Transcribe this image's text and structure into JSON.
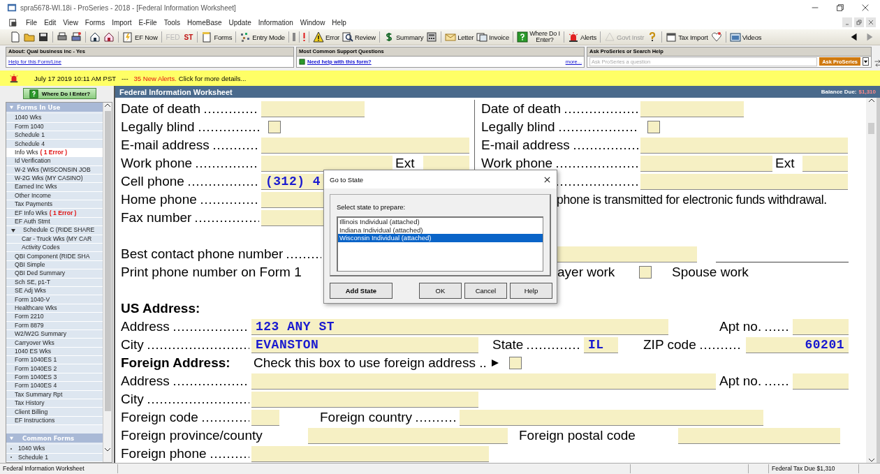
{
  "window": {
    "title": "spra5678-WI.18i - ProSeries - 2018 - [Federal Information Worksheet]"
  },
  "menu": [
    "File",
    "Edit",
    "View",
    "Forms",
    "Import",
    "E-File",
    "Tools",
    "HomeBase",
    "Update",
    "Information",
    "Window",
    "Help"
  ],
  "toolbar_groups": [
    [
      {
        "kind": "icon",
        "disabled": false
      },
      {
        "kind": "icon",
        "disabled": false
      },
      {
        "kind": "icon",
        "disabled": false
      }
    ],
    [
      {
        "kind": "icon",
        "disabled": false
      },
      {
        "kind": "icon",
        "disabled": false
      }
    ],
    [
      {
        "kind": "icon",
        "disabled": false
      },
      {
        "kind": "icon",
        "disabled": false
      }
    ],
    [
      {
        "kind": "labeled",
        "label": "EF Now",
        "disabled": false
      }
    ],
    [
      {
        "kind": "text",
        "label": "FED",
        "disabled": true
      },
      {
        "kind": "text",
        "label": "ST",
        "disabled": false
      }
    ],
    [
      {
        "kind": "labeled",
        "label": "Forms",
        "disabled": false
      }
    ],
    [
      {
        "kind": "labeled",
        "label": "Entry Mode",
        "disabled": false
      }
    ],
    [
      {
        "kind": "icon",
        "disabled": false
      }
    ],
    [
      {
        "kind": "icon",
        "disabled": false
      }
    ],
    [
      {
        "kind": "labeled",
        "label": "Error",
        "disabled": false
      },
      {
        "kind": "labeled",
        "label": "Review",
        "disabled": false
      }
    ],
    [
      {
        "kind": "labeled",
        "label": "Summary",
        "disabled": false
      },
      {
        "kind": "icon",
        "disabled": false
      }
    ],
    [
      {
        "kind": "labeled",
        "label": "Letter",
        "disabled": false
      },
      {
        "kind": "labeled",
        "label": "Invoice",
        "disabled": false
      }
    ],
    [
      {
        "kind": "labeled",
        "label": "Where Do I Enter?",
        "disabled": false
      }
    ],
    [
      {
        "kind": "labeled",
        "label": "Alerts",
        "disabled": false
      }
    ],
    [
      {
        "kind": "labeled",
        "label": "Govt Instr",
        "disabled": true
      },
      {
        "kind": "icon",
        "disabled": false
      }
    ],
    [
      {
        "kind": "labeled",
        "label": "Tax Import",
        "disabled": false
      },
      {
        "kind": "icon",
        "disabled": false
      }
    ],
    [
      {
        "kind": "labeled",
        "label": "Videos",
        "disabled": false
      }
    ]
  ],
  "info_panels": {
    "about": {
      "header": "About: Qual business inc - Yes",
      "link": "Help for this Form/Line"
    },
    "support": {
      "header": "Most Common Support Questions",
      "link": "Need help with this form?",
      "more": "more..."
    },
    "ask": {
      "header": "Ask ProSeries or Search Help",
      "placeholder": "Ask ProSeries a question",
      "button": "Ask ProSeries"
    }
  },
  "alert_bar": {
    "date": "July 17 2019 10:11 AM PST",
    "separator": "---",
    "count": "35 New Alerts.",
    "message": "Click for more details..."
  },
  "sidebar": {
    "button": "Where Do I Enter?",
    "forms_in_use": {
      "header": "Forms In Use",
      "items": [
        {
          "label": "1040 Wks",
          "selected": false
        },
        {
          "label": "Form 1040",
          "selected": false
        },
        {
          "label": "Schedule 1",
          "selected": false
        },
        {
          "label": "Schedule 4",
          "selected": false
        },
        {
          "label": "Info Wks",
          "error": "( 1 Error )",
          "selected": true
        },
        {
          "label": "Id Verification",
          "selected": false
        },
        {
          "label": "W-2 Wks (WISCONSIN JOB",
          "selected": false
        },
        {
          "label": "W-2G Wks (MY CASINO)",
          "selected": false
        },
        {
          "label": "Earned Inc Wks",
          "selected": false
        },
        {
          "label": "Other Income",
          "selected": false
        },
        {
          "label": "Tax Payments",
          "selected": false
        },
        {
          "label": "EF Info Wks",
          "error": "( 1 Error )",
          "selected": false
        },
        {
          "label": "EF Auth Stmt",
          "selected": false
        },
        {
          "label": "Schedule C (RIDE SHARE",
          "selected": false,
          "expanded": true,
          "children": [
            {
              "label": "Car - Truck Wks (MY CAR",
              "selected": false
            },
            {
              "label": "Activity Codes",
              "selected": false
            }
          ]
        },
        {
          "label": "QBI Component (RIDE SHA",
          "selected": false
        },
        {
          "label": "QBI Simple",
          "selected": false
        },
        {
          "label": "QBI Ded Summary",
          "selected": false
        },
        {
          "label": "Sch SE, p1-T",
          "selected": false
        },
        {
          "label": "SE Adj Wks",
          "selected": false
        },
        {
          "label": "Form 1040-V",
          "selected": false
        },
        {
          "label": "Healthcare Wks",
          "selected": false
        },
        {
          "label": "Form 2210",
          "selected": false
        },
        {
          "label": "Form 8879",
          "selected": false
        },
        {
          "label": "W2/W2G Summary",
          "selected": false
        },
        {
          "label": "Carryover Wks",
          "selected": false
        },
        {
          "label": "1040 ES Wks",
          "selected": false
        },
        {
          "label": "Form 1040ES 1",
          "selected": false
        },
        {
          "label": "Form 1040ES 2",
          "selected": false
        },
        {
          "label": "Form 1040ES 3",
          "selected": false
        },
        {
          "label": "Form 1040ES 4",
          "selected": false
        },
        {
          "label": "Tax Summary Rpt",
          "selected": false
        },
        {
          "label": "Tax History",
          "selected": false
        },
        {
          "label": "Client Billing",
          "selected": false
        },
        {
          "label": "EF Instructions",
          "selected": false
        }
      ]
    },
    "common_forms": {
      "header": "Common Forms",
      "items": [
        {
          "label": "1040 Wks",
          "selected": false
        },
        {
          "label": "Schedule 1",
          "selected": false
        }
      ]
    }
  },
  "form": {
    "title": "Federal Information Worksheet",
    "balance_label": "Balance Due:",
    "balance_value": "$1,310",
    "taxpayer": [
      {
        "kind": "date",
        "label": "Date of death"
      },
      {
        "kind": "checkbox",
        "label": "Legally blind",
        "checked": false
      },
      {
        "kind": "field",
        "label": "E-mail address"
      },
      {
        "kind": "phone-ext",
        "label": "Work phone",
        "ext_label": "Ext"
      },
      {
        "kind": "field",
        "label": "Cell phone",
        "value": "(312) 4"
      },
      {
        "kind": "field",
        "label": "Home phone"
      },
      {
        "kind": "field",
        "label": "Fax number"
      }
    ],
    "spouse": [
      {
        "kind": "date",
        "label": "Date of death"
      },
      {
        "kind": "checkbox",
        "label": "Legally blind",
        "checked": false
      },
      {
        "kind": "field",
        "label": "E-mail address"
      },
      {
        "kind": "phone-ext",
        "label": "Work phone",
        "ext_label": "Ext"
      },
      {
        "kind": "field"
      }
    ],
    "spouse_note": "phone is transmitted for electronic funds withdrawal.",
    "best_contact": {
      "label": "Best contact phone number"
    },
    "print_phone": {
      "label": "Print phone number on Form 1",
      "taxpayer_label": "ayer work",
      "taxpayer_checked": false,
      "spouse_label": "Spouse work"
    },
    "us_address": {
      "heading": "US Address:",
      "address_label": "Address",
      "address": "123 ANY ST",
      "apt_label": "Apt no.",
      "city_label": "City",
      "city": "EVANSTON",
      "state_label": "State",
      "state": "IL",
      "zip_label": "ZIP code",
      "zip": "60201"
    },
    "foreign_address": {
      "heading": "Foreign Address:",
      "check_label": "Check this box to use foreign address ..",
      "checked": false,
      "address_label": "Address",
      "apt_label": "Apt no.",
      "city_label": "City",
      "code_label": "Foreign code",
      "country_label": "Foreign country",
      "province_label": "Foreign province/county",
      "postal_label": "Foreign postal code",
      "phone_label": "Foreign phone"
    }
  },
  "dialog": {
    "title": "Go to State",
    "prompt": "Select state to prepare:",
    "states": [
      {
        "label": "Illinois Individual (attached)",
        "selected": false
      },
      {
        "label": "Indiana Individual (attached)",
        "selected": false
      },
      {
        "label": "Wisconsin Individual (attached)",
        "selected": true
      }
    ],
    "buttons": [
      "Add State",
      "OK",
      "Cancel",
      "Help"
    ]
  },
  "status_bar": {
    "left": "Federal Information Worksheet",
    "right": "Federal Tax Due $1,310"
  }
}
